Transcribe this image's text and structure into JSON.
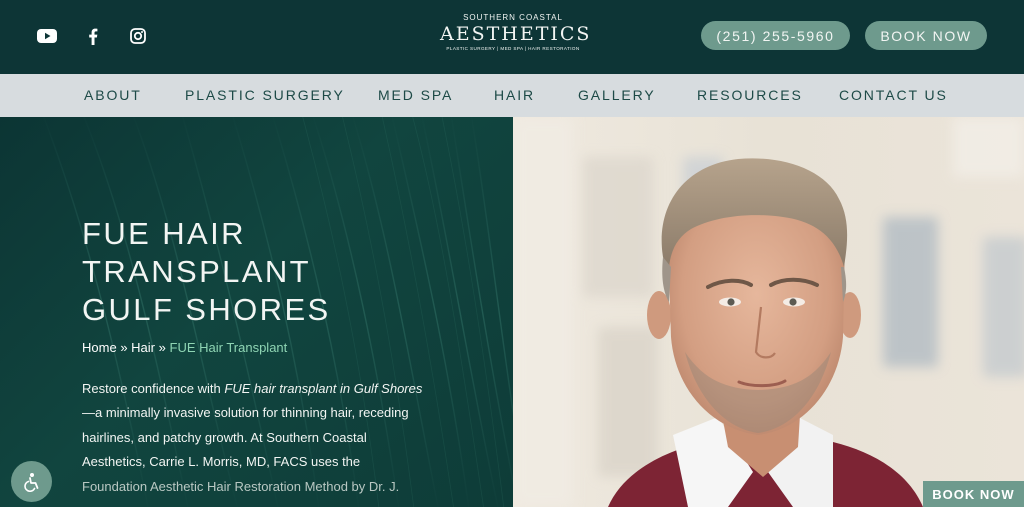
{
  "header": {
    "social": [
      {
        "icon": "youtube-icon"
      },
      {
        "icon": "facebook-icon"
      },
      {
        "icon": "instagram-icon"
      }
    ],
    "logo": {
      "top": "SOUTHERN COASTAL",
      "main": "AESTHETICS",
      "sub": "PLASTIC SURGERY | MED SPA | HAIR RESTORATION"
    },
    "phone_label": "(251) 255-5960",
    "book_label": "BOOK NOW"
  },
  "nav": {
    "items": [
      "ABOUT",
      "PLASTIC SURGERY",
      "MED SPA",
      "HAIR",
      "GALLERY",
      "RESOURCES",
      "CONTACT US"
    ]
  },
  "hero": {
    "title_lines": [
      "FUE HAIR",
      "TRANSPLANT",
      "GULF SHORES"
    ],
    "breadcrumb": {
      "home": "Home",
      "sep": "»",
      "hair": "Hair",
      "current": "FUE Hair Transplant"
    },
    "body": {
      "intro": "Restore confidence with",
      "em": "FUE hair transplant in Gulf Shores",
      "rest": "—a minimally invasive solution for thinning hair, receding hairlines, and patchy growth. At Southern Coastal Aesthetics, Carrie L. Morris, MD, FACS uses the",
      "fade": "Foundation Aesthetic Hair Restoration Method by Dr. J."
    }
  },
  "floating": {
    "accessibility_icon": "accessibility-icon",
    "book_label": "BOOK NOW"
  },
  "colors": {
    "header_bg": "#0d3536",
    "nav_bg": "#d7dcdf",
    "accent": "#6e9a8d",
    "hero_bg": "#0f3a3a",
    "link_accent": "#8fd5b4"
  }
}
